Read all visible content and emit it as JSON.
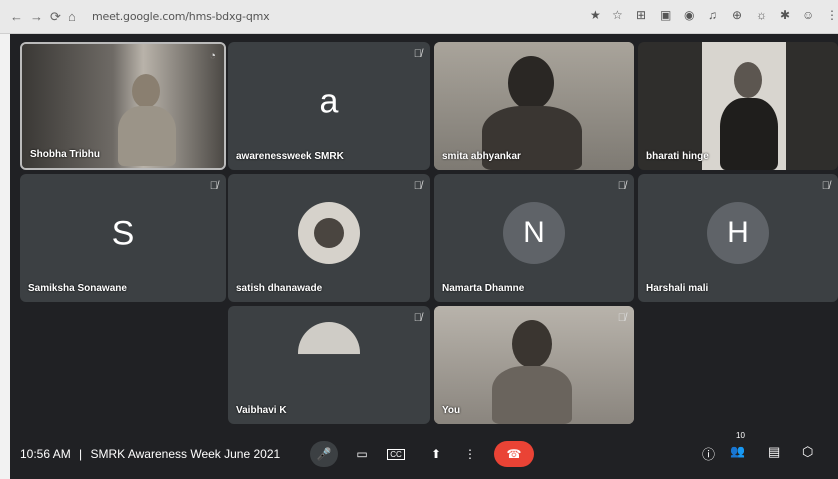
{
  "browser": {
    "url": "meet.google.com/hms-bdxg-qmx",
    "nav_back": "←",
    "nav_forward": "→",
    "nav_reload": "⟳",
    "nav_home": "⌂",
    "lock": "🔒",
    "extensions": [
      "★",
      "☆",
      "⊞",
      "▣",
      "◉",
      "♫",
      "⊕",
      "☼",
      "✱",
      "☺",
      "⋮"
    ]
  },
  "participants": [
    {
      "name": "Shobha Tribhu",
      "type": "video",
      "highlight": true
    },
    {
      "name": "awarenessweek SMRK",
      "type": "letter",
      "letter": "a",
      "muted": true
    },
    {
      "name": "smita abhyankar",
      "type": "video",
      "muted": false
    },
    {
      "name": "bharati hinge",
      "type": "video",
      "muted": false
    },
    {
      "name": "Samiksha Sonawane",
      "type": "letter",
      "letter": "S",
      "muted": true
    },
    {
      "name": "satish dhanawade",
      "type": "avatar-photo",
      "muted": true
    },
    {
      "name": "Namarta Dhamne",
      "type": "circle",
      "letter": "N",
      "muted": true
    },
    {
      "name": "Harshali mali",
      "type": "circle",
      "letter": "H",
      "muted": true
    },
    {
      "name": "Vaibhavi K",
      "type": "avatar-photo",
      "muted": true
    },
    {
      "name": "You",
      "type": "video",
      "muted": true
    }
  ],
  "mic_glyph": "🎙̸",
  "bottom_bar": {
    "time": "10:56 AM",
    "separator": "|",
    "meeting_title": "SMRK Awareness Week June 2021",
    "controls": {
      "mic": "🎤",
      "camera": "▭",
      "captions": "CC",
      "present": "⬆",
      "more": "⋮",
      "end": "☎"
    },
    "right": {
      "info": "ⓘ",
      "people": "👥",
      "people_count": "10",
      "chat": "▤",
      "activities": "⬡"
    }
  },
  "colors": {
    "background": "#202124",
    "tile": "#3c4043",
    "end_call": "#ea4335"
  }
}
